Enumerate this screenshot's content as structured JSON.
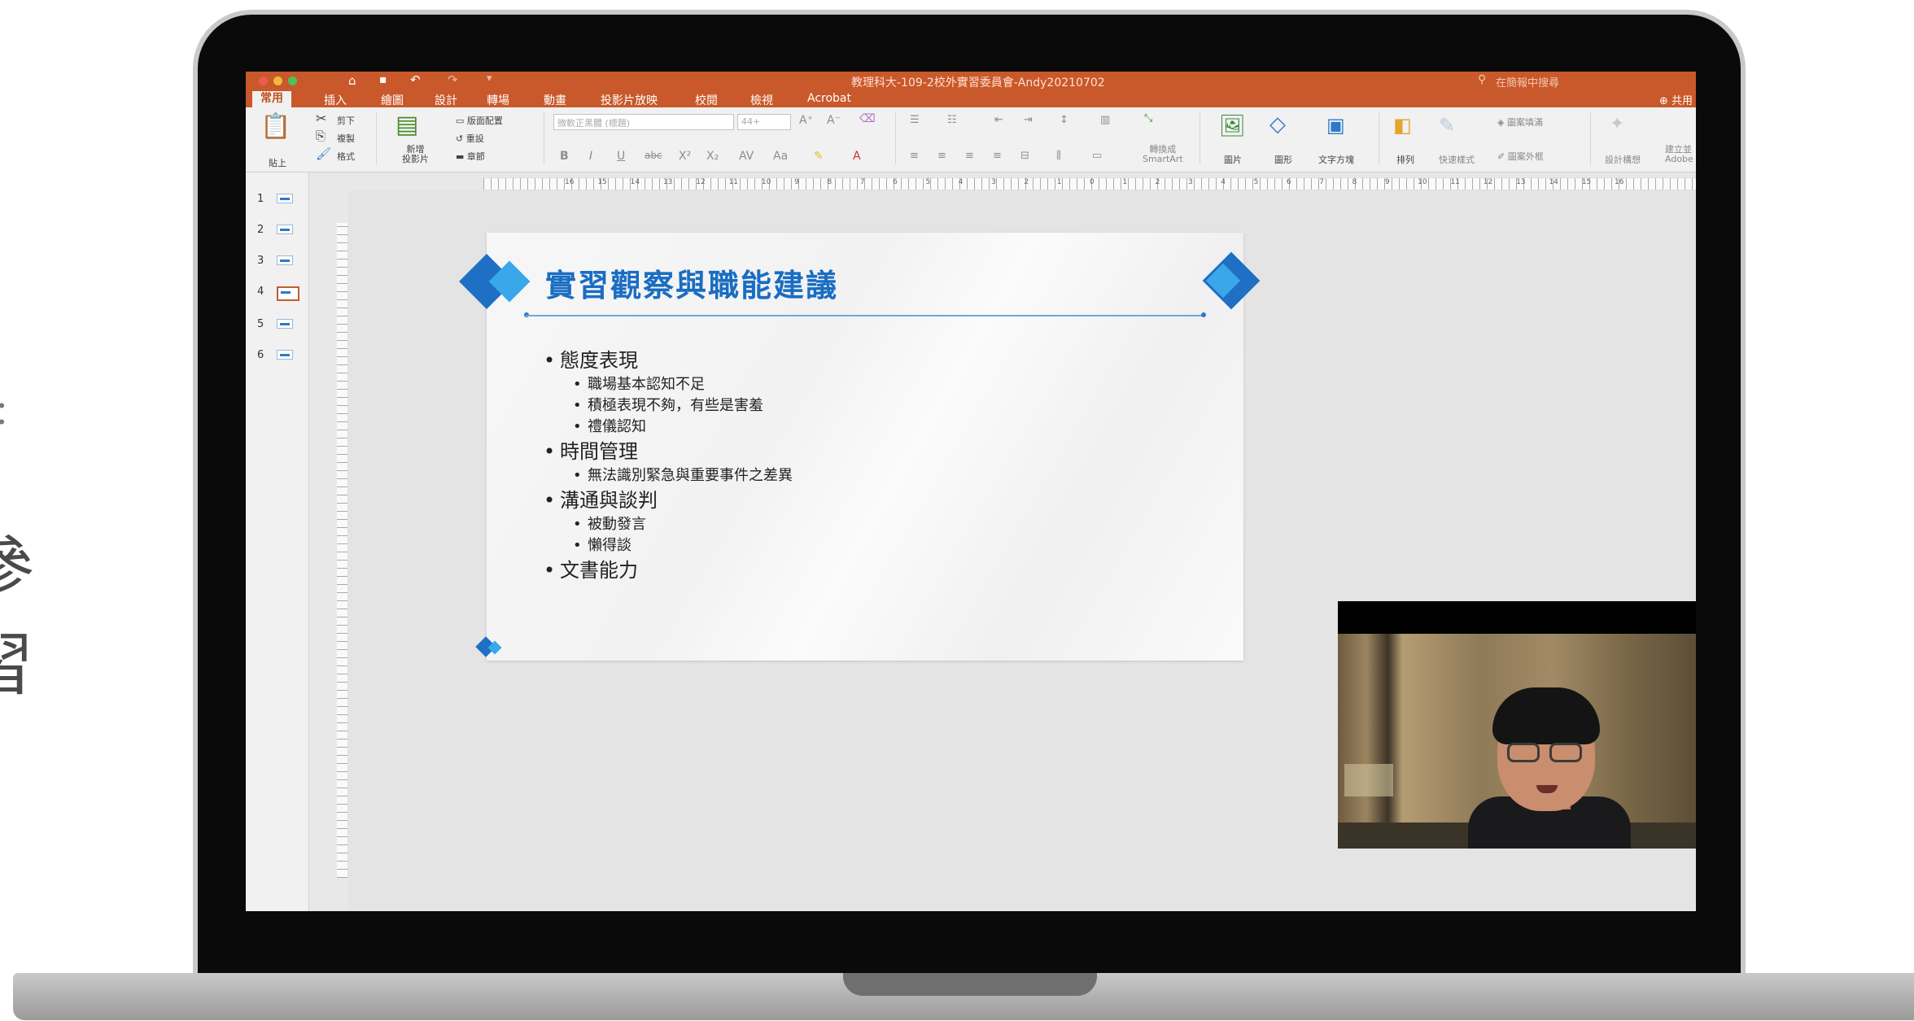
{
  "background": {
    "left_text": [
      "參",
      "習"
    ],
    "left_mark": "："
  },
  "window": {
    "title": "教理科大-109-2校外實習委員會-Andy20210702",
    "search_placeholder": "在簡報中搜尋",
    "share": "共用",
    "quick_access": {
      "home": "⌂",
      "save": "💾",
      "undo": "↶",
      "redo": "↷",
      "more": "▾"
    }
  },
  "ribbon": {
    "tabs": [
      "常用",
      "插入",
      "繪圖",
      "設計",
      "轉場",
      "動畫",
      "投影片放映",
      "校閱",
      "檢視",
      "Acrobat"
    ],
    "active_tab": "常用",
    "clipboard": {
      "paste": "貼上",
      "cut": "剪下",
      "copy": "複製",
      "format": "格式"
    },
    "slides": {
      "new_slide": "新增\n投影片",
      "layout": "版面配置",
      "reset": "重設",
      "section": "章節"
    },
    "font": {
      "family": "微軟正黑體 (標題)",
      "size": "44+"
    },
    "drawing": {
      "convert": "轉換成\nSmartArt",
      "picture": "圖片",
      "shapes": "圖形",
      "textbox": "文字方塊",
      "arrange": "排列",
      "quick_styles": "快速樣式",
      "shape_fill": "圖案填滿",
      "shape_outline": "圖案外框",
      "design_ideas": "設計構想",
      "create_pdf": "建立並\nAdobe"
    }
  },
  "ruler_labels": [
    "16",
    "15",
    "14",
    "13",
    "12",
    "11",
    "10",
    "9",
    "8",
    "7",
    "6",
    "5",
    "4",
    "3",
    "2",
    "1",
    "0",
    "1",
    "2",
    "3",
    "4",
    "5",
    "6",
    "7",
    "8",
    "9",
    "10",
    "11",
    "12",
    "13",
    "14",
    "15",
    "16"
  ],
  "thumbnails": [
    {
      "num": "1"
    },
    {
      "num": "2"
    },
    {
      "num": "3"
    },
    {
      "num": "4"
    },
    {
      "num": "5"
    },
    {
      "num": "6"
    }
  ],
  "selected_slide": 4,
  "slide": {
    "title": "實習觀察與職能建議",
    "sections": [
      {
        "heading": "態度表現",
        "items": [
          "職場基本認知不足",
          "積極表現不夠，有些是害羞",
          "禮儀認知"
        ]
      },
      {
        "heading": "時間管理",
        "items": [
          "無法識別緊急與重要事件之差異"
        ]
      },
      {
        "heading": "溝通與談判",
        "items": [
          "被動發言",
          "懶得談"
        ]
      },
      {
        "heading": "文書能力",
        "items": []
      }
    ]
  },
  "colors": {
    "titlebar": "#c9582a",
    "slide_title": "#1a6dc2",
    "diamond_dark": "#1f6fc4",
    "diamond_light": "#39a7ea"
  }
}
